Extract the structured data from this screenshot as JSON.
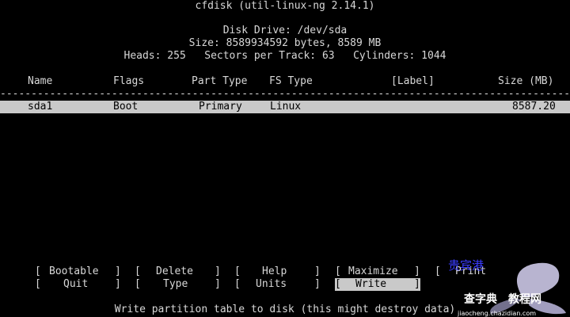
{
  "header": {
    "app_title": "cfdisk (util-linux-ng 2.14.1)",
    "disk_drive_line": "Disk Drive: /dev/sda",
    "size_line": "Size: 8589934592 bytes, 8589 MB",
    "geometry_line": "Heads: 255   Sectors per Track: 63   Cylinders: 1044"
  },
  "table": {
    "columns": [
      "Name",
      "Flags",
      "Part Type",
      "FS Type",
      "[Label]",
      "Size (MB)"
    ],
    "separator": "----------------------------------------------------------------------------------------------------------------",
    "rows": [
      {
        "name": "sda1",
        "flags": "Boot",
        "part_type": "Primary",
        "fs_type": "Linux",
        "label": "",
        "size_mb": "8587.20",
        "selected": true
      }
    ]
  },
  "menu": {
    "items": [
      {
        "label": "Bootable",
        "active": false
      },
      {
        "label": "Delete",
        "active": false
      },
      {
        "label": "Help",
        "active": false
      },
      {
        "label": "Maximize",
        "active": false
      },
      {
        "label": "Print",
        "active": false
      },
      {
        "label": "Quit",
        "active": false
      },
      {
        "label": "Type",
        "active": false
      },
      {
        "label": "Units",
        "active": false
      },
      {
        "label": "Write",
        "active": true
      }
    ]
  },
  "status_line": "Write partition table to disk (this might destroy data)",
  "watermark": {
    "text_cn": "查字典",
    "text_cn2": "教程网",
    "text_small": "jiaocheng.chazidian.com",
    "text_top": "贵宾港"
  },
  "colors": {
    "background": "#000000",
    "foreground": "#d8d8d8",
    "highlight_bg": "#c9c9c9",
    "highlight_fg": "#000000"
  }
}
